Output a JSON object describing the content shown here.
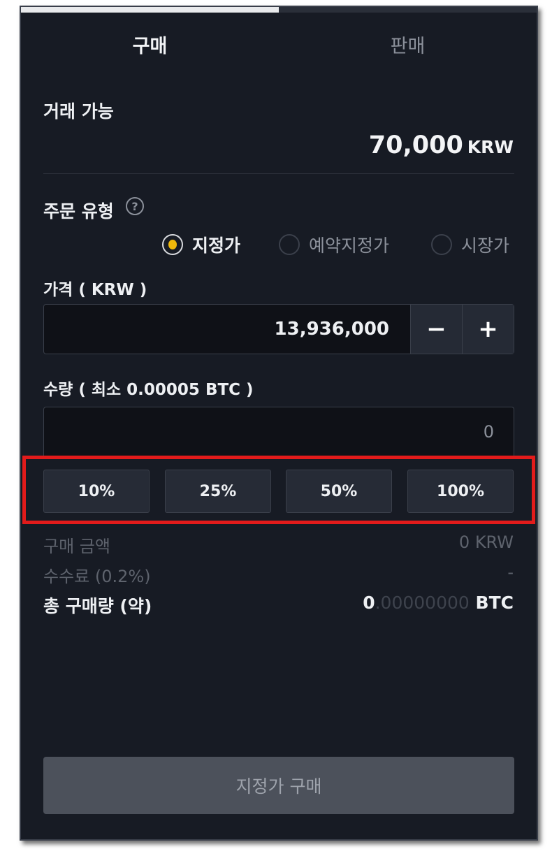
{
  "tabs": {
    "buy": "구매",
    "sell": "판매"
  },
  "available": {
    "label": "거래 가능",
    "amount": "70,000",
    "unit": "KRW"
  },
  "order_type": {
    "label": "주문 유형",
    "help_icon": "?",
    "options": [
      {
        "label": "지정가",
        "selected": true
      },
      {
        "label": "예약지정가",
        "selected": false
      },
      {
        "label": "시장가",
        "selected": false
      }
    ]
  },
  "price": {
    "label": "가격 ( KRW )",
    "value": "13,936,000",
    "minus": "−",
    "plus": "+"
  },
  "quantity": {
    "label": "수량 ( 최소 0.00005 BTC )",
    "placeholder": "0",
    "percent_buttons": [
      "10%",
      "25%",
      "50%",
      "100%"
    ]
  },
  "summary": {
    "buy_amount_label": "구매 금액",
    "buy_amount_value": "0 KRW",
    "fee_label": "수수료 (0.2%)",
    "fee_value": "-",
    "total_label": "총 구매량 (약)",
    "total_int": "0",
    "total_frac": ".00000000",
    "total_unit": "BTC"
  },
  "submit_label": "지정가 구매",
  "colors": {
    "accent_radio": "#f0b90b",
    "highlight_border": "#e21b1b",
    "panel_bg": "#171b24"
  }
}
